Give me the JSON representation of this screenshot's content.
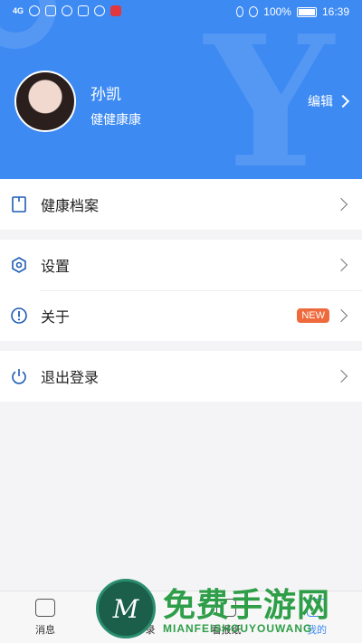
{
  "statusbar": {
    "network": "4G",
    "battery": "100%",
    "time": "16:39"
  },
  "profile": {
    "name": "孙凯",
    "subtitle": "健健康康",
    "edit_label": "编辑"
  },
  "menu": {
    "health_record": "健康档案",
    "settings": "设置",
    "about": "关于",
    "about_badge": "NEW",
    "logout": "退出登录"
  },
  "bottom_nav": [
    {
      "label": "消息",
      "icon": "message-icon"
    },
    {
      "label": "录",
      "icon": "record-icon"
    },
    {
      "label": "看报纸",
      "icon": "newspaper-icon"
    },
    {
      "label": "我的",
      "icon": "user-icon"
    }
  ],
  "watermark": {
    "title": "免费手游网",
    "subtitle": "MIANFEISHOUYOUWANG",
    "logo_letter": "M"
  },
  "colors": {
    "header": "#3d8af3",
    "badge": "#ee6a3c",
    "watermark": "#2e9e48"
  }
}
